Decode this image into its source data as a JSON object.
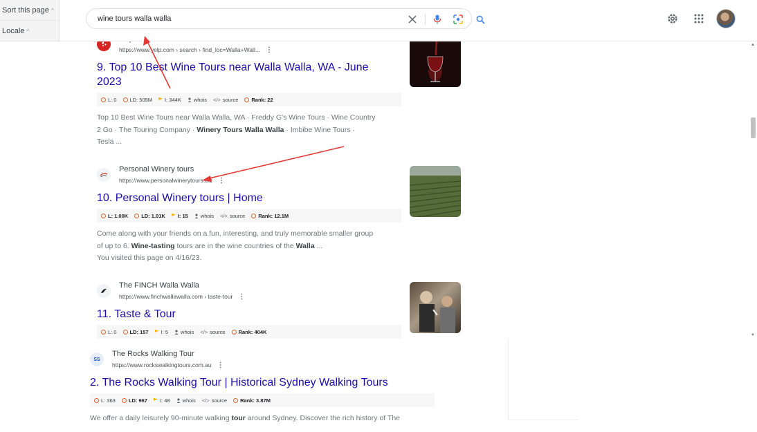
{
  "side_panel": {
    "sort_label": "Sort this page",
    "locale_label": "Locale"
  },
  "search": {
    "query": "wine tours walla walla"
  },
  "results": [
    {
      "site_name": "Yelp",
      "url": "https://www.yelp.com › search › find_loc=Walla+Wall...",
      "number": "9.",
      "title_line1": "Top 10 Best Wine Tours near Walla Walla, WA - June",
      "title_line2": "2023",
      "metrics": {
        "l": "L: 0",
        "ld": "LD: 505M",
        "i": "I: 344K",
        "whois": "whois",
        "source": "source",
        "rank": "Rank: 22"
      },
      "snippet_1": "Top 10 Best Wine Tours near Walla Walla, WA · Freddy G's Wine Tours · Wine Country",
      "snippet_2a": "2 Go · The Touring Company · ",
      "snippet_2b": "Winery Tours Walla Walla",
      "snippet_2c": " · Imbibe Wine Tours ·",
      "snippet_3": "Tesla ..."
    },
    {
      "site_name": "Personal Winery tours",
      "url": "https://www.personalwinerytours.biz",
      "number": "10.",
      "title": "Personal Winery tours | Home",
      "metrics": {
        "l": "L: 1.00K",
        "ld": "LD: 1.01K",
        "i": "I: 15",
        "whois": "whois",
        "source": "source",
        "rank": "Rank: 12.1M"
      },
      "snippet_1": "Come along with your friends on a fun, interesting, and truly memorable smaller group",
      "snippet_2a": "of up to 6. ",
      "snippet_2b": "Wine-tasting",
      "snippet_2c": " tours are in the wine countries of the ",
      "snippet_2d": "Walla",
      "snippet_2e": " ...",
      "snippet_3": "You visited this page on 4/16/23."
    },
    {
      "site_name": "The FINCH Walla Walla",
      "url": "https://www.finchwallawalla.com › taste-tour",
      "number": "11.",
      "title": "Taste & Tour",
      "metrics": {
        "l": "L: 0",
        "ld": "LD: 157",
        "i": "I: 5",
        "whois": "whois",
        "source": "source",
        "rank": "Rank: 404K"
      }
    },
    {
      "site_name": "The Rocks Walking Tour",
      "url": "https://www.rockswalkingtours.com.au",
      "number": "2.",
      "title": "The Rocks Walking Tour | Historical Sydney Walking Tours",
      "metrics": {
        "l": "L: 363",
        "ld": "LD: 967",
        "i": "I: 48",
        "whois": "whois",
        "source": "source",
        "rank": "Rank: 3.87M"
      },
      "snippet_1a": "We offer a daily leisurely 90-minute walking ",
      "snippet_1b": "tour",
      "snippet_1c": " around Sydney. Discover the rich history of The"
    }
  ],
  "colors": {
    "link": "#1a0dab",
    "metric_ring": "#d9622b",
    "annotation_arrow": "#e53935"
  }
}
